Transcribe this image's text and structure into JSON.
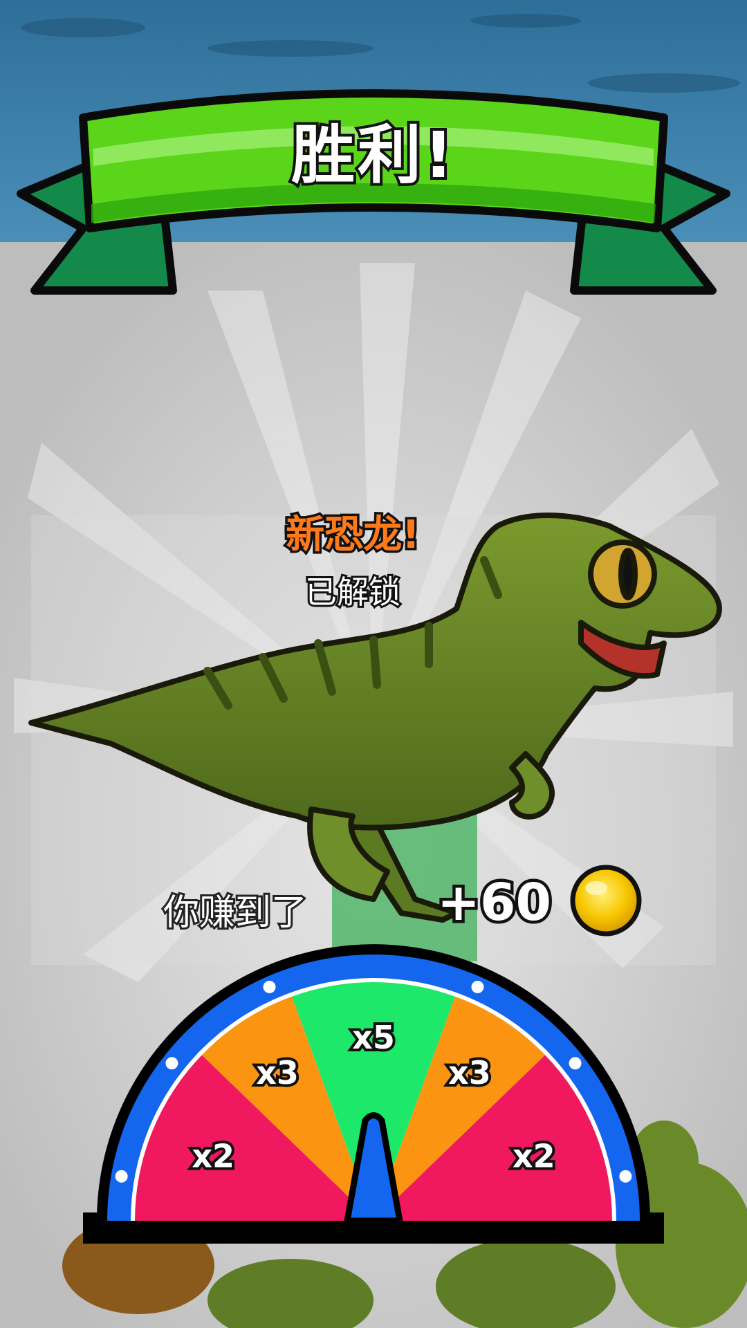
{
  "banner": {
    "title": "胜利!"
  },
  "unlock": {
    "title": "新恐龙!",
    "subtitle": "已解锁"
  },
  "reward": {
    "label": "你赚到了",
    "amount": "+60",
    "icon": "coin-icon"
  },
  "wheel": {
    "segments": [
      {
        "label": "x2",
        "color": "#f0185f"
      },
      {
        "label": "x3",
        "color": "#fb9410"
      },
      {
        "label": "x5",
        "color": "#1ee86a"
      },
      {
        "label": "x3",
        "color": "#fb9410"
      },
      {
        "label": "x2",
        "color": "#f0185f"
      }
    ],
    "rim_color": "#1466ee",
    "needle_color": "#1466ee",
    "needle_value": 0.5
  },
  "colors": {
    "banner_green": "#5ad51a",
    "banner_dark_green": "#138a4a",
    "coin_gold": "#f7c600"
  }
}
